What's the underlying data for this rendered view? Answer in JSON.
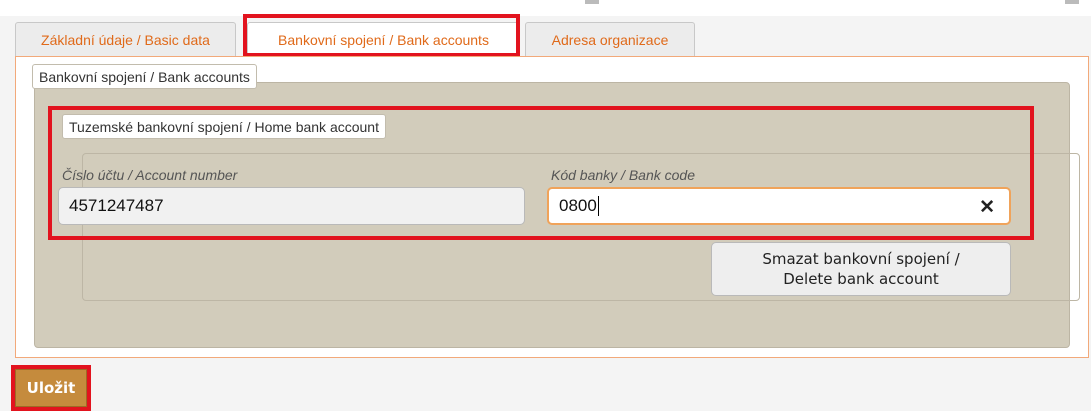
{
  "tabs": [
    {
      "label": "Základní údaje / Basic data",
      "active": false
    },
    {
      "label": "Bankovní spojení / Bank accounts",
      "active": true
    },
    {
      "label": "Adresa organizace",
      "active": false
    }
  ],
  "section": {
    "legend": "Bankovní spojení / Bank accounts",
    "home_account": {
      "legend": "Tuzemské bankovní spojení / Home bank account",
      "account_number": {
        "label": "Číslo účtu / Account number",
        "value": "4571247487"
      },
      "bank_code": {
        "label": "Kód banky / Bank code",
        "value": "0800"
      },
      "clear_glyph": "✕"
    },
    "delete_button": {
      "line1": "Smazat bankovní spojení /",
      "line2": "Delete bank account"
    }
  },
  "save_button": {
    "label": "Uložit"
  },
  "colors": {
    "accent_orange": "#e06a1a",
    "highlight_red": "#e2131e",
    "panel_beige": "#d2ccbb",
    "save_brown": "#c58b3d"
  }
}
